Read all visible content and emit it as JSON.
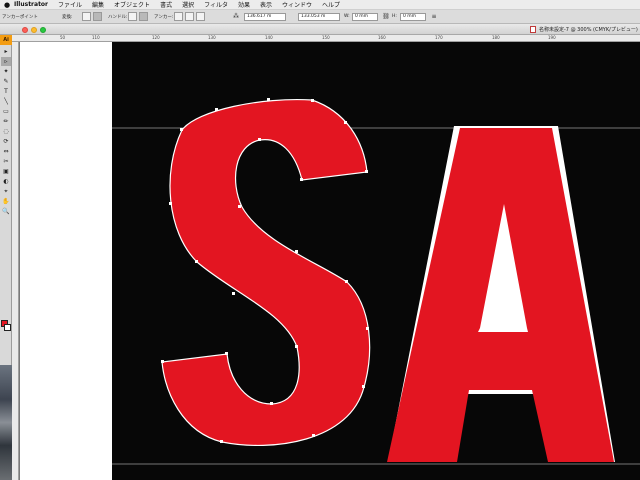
{
  "menubar": {
    "apple_icon": "apple-icon",
    "app_name": "Illustrator",
    "items": [
      "ファイル",
      "編集",
      "オブジェクト",
      "書式",
      "選択",
      "フィルタ",
      "効果",
      "表示",
      "ウィンドウ",
      "ヘルプ"
    ]
  },
  "control_bar": {
    "anchor_point_label": "アンカーポイント",
    "convert_label": "変換:",
    "handle_label": "ハンドル:",
    "anchor_label": "アンカー:",
    "x_value": "136.617 m",
    "y_value": "133.053 m",
    "w_label": "W:",
    "w_value": "0 mm",
    "h_label": "H:",
    "h_value": "0 mm"
  },
  "document": {
    "title": "名称未設定-7 @ 300% (CMYK/プレビュー)"
  },
  "ruler": {
    "labels": [
      "50",
      "110",
      "120",
      "130",
      "140",
      "150",
      "160",
      "170",
      "180",
      "190"
    ]
  },
  "tool_panel": {
    "badge": "Ai",
    "tools": [
      "▸",
      "▹",
      "✦",
      "✎",
      "T",
      "╲",
      "▭",
      "✏",
      "◌",
      "⟳",
      "⇔",
      "✂",
      "▣",
      "◐",
      "⌖",
      "✋",
      "🔍"
    ]
  },
  "artwork": {
    "text_glyphs": "SA",
    "fill_color": "#e31521",
    "background_color": "#070707",
    "selection_color": "#ffffff"
  }
}
